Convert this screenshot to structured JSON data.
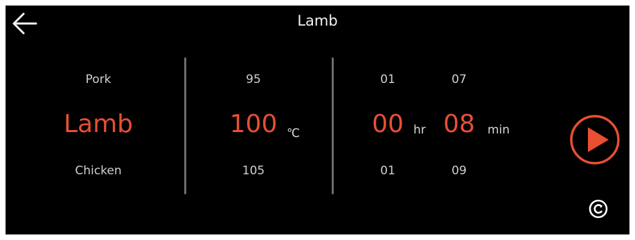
{
  "header": {
    "title": "Lamb",
    "back_icon": "arrow-left-icon"
  },
  "food_picker": {
    "above": "Pork",
    "selected": "Lamb",
    "below": "Chicken"
  },
  "temperature_picker": {
    "above": "95",
    "selected": "100",
    "below": "105",
    "unit": "℃"
  },
  "hours_picker": {
    "above": "01",
    "selected": "00",
    "below": "01",
    "unit": "hr"
  },
  "minutes_picker": {
    "above": "07",
    "selected": "08",
    "below": "09",
    "unit": "min"
  },
  "controls": {
    "start_icon": "play-icon",
    "reset_icon": "reset-icon"
  },
  "colors": {
    "accent": "#e84f33",
    "background": "#000000",
    "text": "#d8d8d8",
    "divider": "#6d6d6d"
  }
}
